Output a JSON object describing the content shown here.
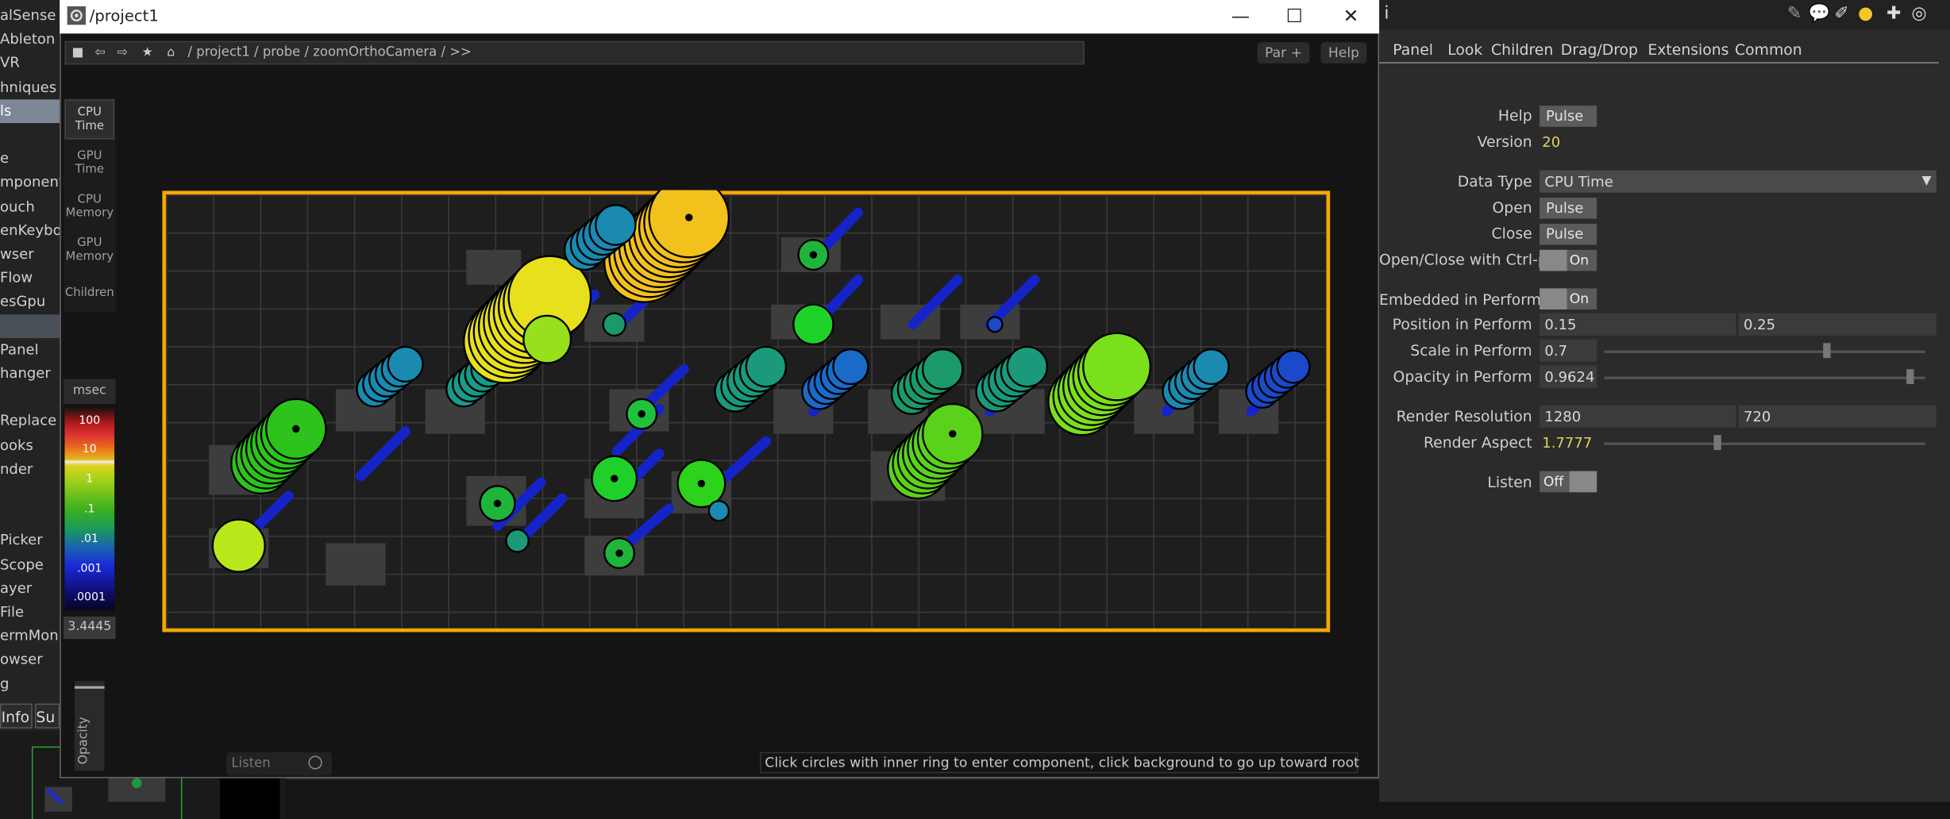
{
  "background_app": {
    "palette_items": [
      "alSense",
      "Ableton",
      "VR",
      "hniques",
      "ls",
      "",
      "e",
      "mponents",
      "ouch",
      "enKeybo",
      "wser",
      "Flow",
      "esGpu",
      "",
      "Panel",
      "hanger",
      "",
      "Replace",
      "ooks",
      "nder",
      "",
      "",
      "Picker",
      "Scope",
      "ayer",
      "File",
      "ermMonito",
      "owser",
      "g"
    ],
    "bottom_tabs": [
      "Info",
      "Su"
    ]
  },
  "window": {
    "title": "/project1",
    "controls": {
      "minimize": "—",
      "maximize": "☐",
      "close": "✕"
    }
  },
  "navbar": {
    "breadcrumb": "/ project1 / probe / zoomOrthoCamera / >>",
    "par_button": "Par +",
    "help_button": "Help"
  },
  "mode_menu": [
    {
      "label": "CPU Time",
      "active": true
    },
    {
      "label": "GPU Time",
      "active": false
    },
    {
      "label": "CPU Memory",
      "active": false
    },
    {
      "label": "GPU Memory",
      "active": false
    },
    {
      "label": "Children",
      "active": false
    }
  ],
  "legend": {
    "unit": "msec",
    "ticks": [
      "100",
      "10",
      "1",
      ".1",
      ".01",
      ".001",
      ".0001"
    ],
    "readout": "3.4445"
  },
  "opacity_label": "Opacity",
  "listen_label": "Listen",
  "hint": "Click circles with inner ring to enter component, click background to go up toward root",
  "panel": {
    "tabs": [
      "Panel",
      "Look",
      "Children",
      "Drag/Drop",
      "Extensions",
      "Common"
    ],
    "params": {
      "help": {
        "label": "Help",
        "value": "Pulse"
      },
      "version": {
        "label": "Version",
        "value": "20"
      },
      "data_type": {
        "label": "Data Type",
        "value": "CPU Time"
      },
      "open": {
        "label": "Open",
        "value": "Pulse"
      },
      "close": {
        "label": "Close",
        "value": "Pulse"
      },
      "open_close_ctrlp": {
        "label": "Open/Close with Ctrl-p",
        "value": "On"
      },
      "embedded": {
        "label": "Embedded in Perform",
        "value": "On"
      },
      "position": {
        "label": "Position in Perform",
        "x": "0.15",
        "y": "0.25"
      },
      "scale": {
        "label": "Scale in Perform",
        "value": "0.7",
        "level": 0.7
      },
      "opacity": {
        "label": "Opacity in Perform",
        "value": "0.9624",
        "level": 0.9624
      },
      "render_res": {
        "label": "Render Resolution",
        "w": "1280",
        "h": "720"
      },
      "render_aspect": {
        "label": "Render Aspect",
        "value": "1.7777",
        "level": 0.35
      },
      "listen": {
        "label": "Listen",
        "value": "Off"
      }
    }
  },
  "colors": {
    "frame": "#f5a800",
    "accent_yellow": "#e3d25a"
  }
}
